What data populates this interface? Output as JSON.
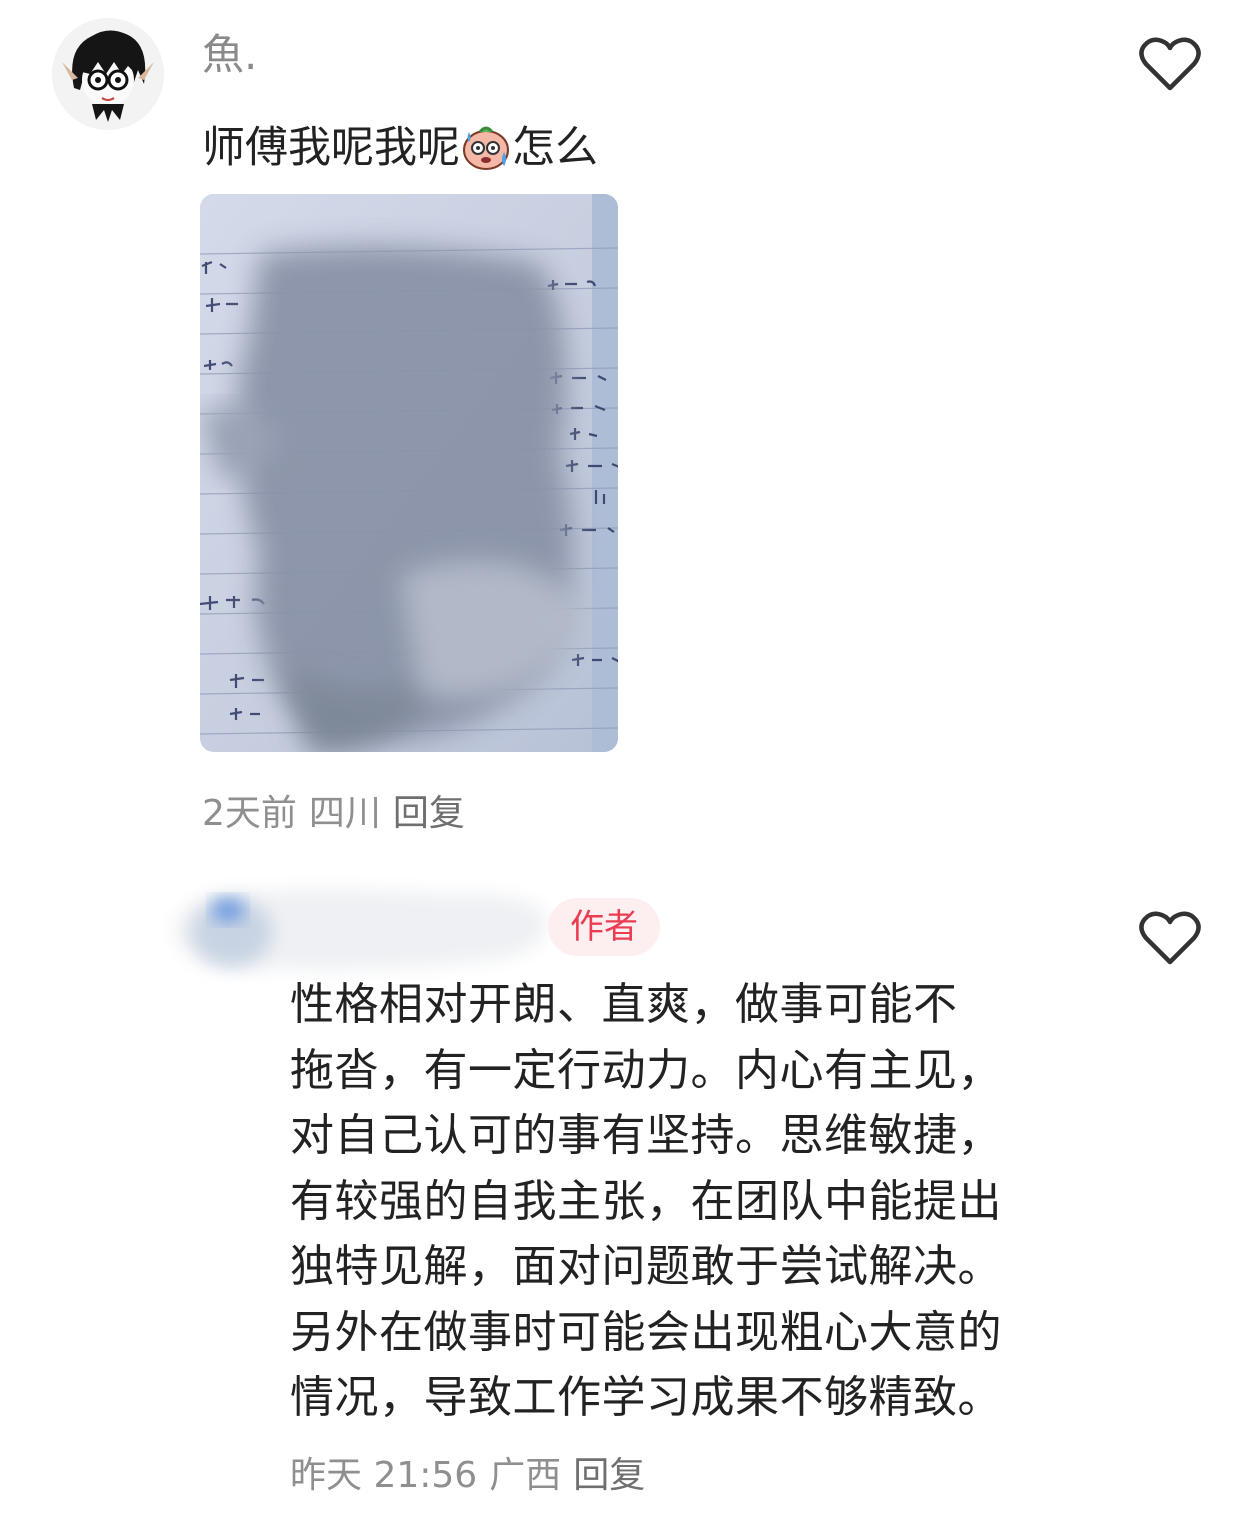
{
  "comments": [
    {
      "username": "魚.",
      "text": "师傅我呢我呢",
      "emoji_icon": "sweating-face-emoji",
      "text_after_emoji": "怎么",
      "time": "2天前",
      "location": "四川",
      "reply_label": "回复"
    },
    {
      "author_badge": "作者",
      "text_lines": [
        "性格相对开朗、直爽，做事可能不",
        "拖沓，有一定行动力。内心有主见，",
        "对自己认可的事有坚持。思维敏捷，",
        "有较强的自我主张，在团队中能提出",
        "独特见解，面对问题敢于尝试解决。",
        "另外在做事时可能会出现粗心大意的",
        "情况，导致工作学习成果不够精致。"
      ],
      "time": "昨天 21:56",
      "location": "广西",
      "reply_label": "回复"
    }
  ],
  "icons": {
    "like": "heart-outline-icon"
  },
  "colors": {
    "author_badge_text": "#ea3d53",
    "author_badge_bg": "#fdeef0",
    "meta_text": "#8f8f8f"
  }
}
